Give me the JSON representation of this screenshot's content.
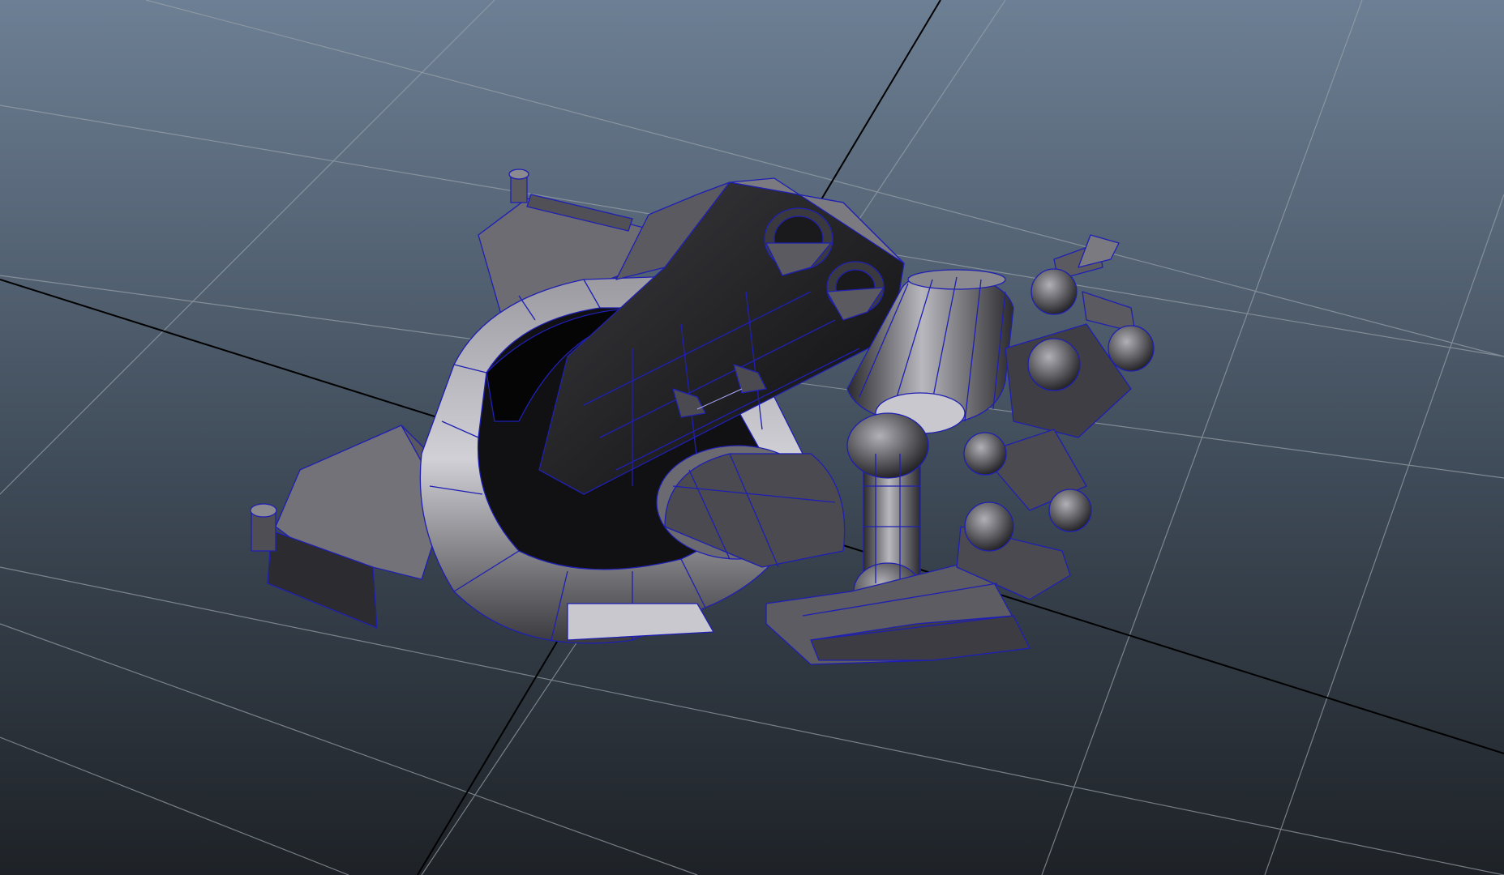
{
  "viewport": {
    "background_top": "#6d7f94",
    "background_bottom": "#1e2227",
    "grid_line_color": "#9aa3ab",
    "axis_line_color": "#000000",
    "wireframe_color": "#1f1fb4",
    "shaded_dark": "#1a1a1c",
    "shaded_mid": "#4a4a4e",
    "shaded_light": "#8c8c92",
    "highlight": "#d8d8dc"
  }
}
